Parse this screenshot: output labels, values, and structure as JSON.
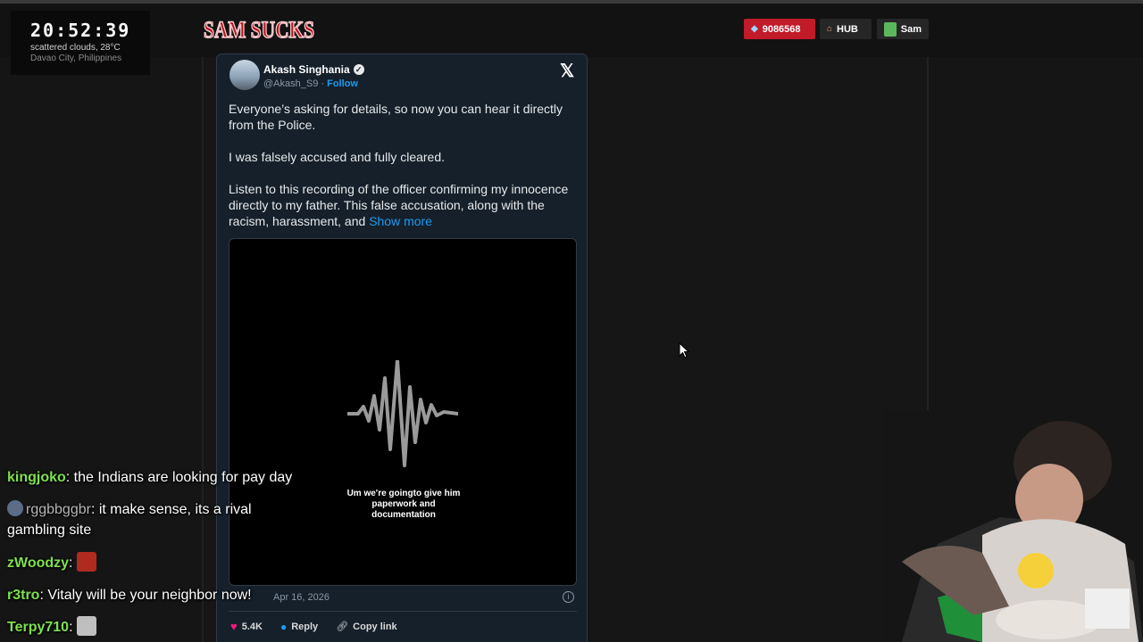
{
  "overlay": {
    "clock": "20:52:39",
    "weather": "scattered clouds, 28°C",
    "city": "Davao City, Philippines",
    "logo_text": "SAM SUCKS",
    "points_value": "9086568",
    "hub_label": "HUB",
    "user_label": "Sam"
  },
  "tweet": {
    "author_name": "Akash Singhania",
    "handle": "@Akash_S9",
    "separator": "·",
    "follow_label": "Follow",
    "paragraph_1": "Everyone’s asking for details, so now you can hear it directly from the Police.",
    "paragraph_2": "I was falsely accused and fully cleared.",
    "paragraph_3": "Listen to this recording of the officer confirming my innocence directly to my father. This false accusation, along with the racism, harassment, and",
    "show_more": "Show more",
    "caption_line_1": "Um we're goingto give him",
    "caption_line_2": "paperwork and",
    "caption_line_3": "documentation",
    "date": "Apr 16, 2026",
    "likes": "5.4K",
    "reply_label": "Reply",
    "copy_link_label": "Copy link"
  },
  "chat": [
    {
      "user": "kingjoko",
      "text": ": the Indians are looking for pay day"
    },
    {
      "user": "rggbbggbr",
      "text": ": it make sense, its a rival gambling site"
    },
    {
      "user": "zWoodzy",
      "text": ":"
    },
    {
      "user": "r3tro",
      "text": ": Vitaly will be your neighbor now!"
    },
    {
      "user": "Terpy710",
      "text": ":"
    }
  ],
  "colors": {
    "accent_blue": "#1d9bf0",
    "tweet_bg": "#15202b",
    "points_red": "#c11b2a",
    "chat_name_green": "#7ee04f"
  }
}
